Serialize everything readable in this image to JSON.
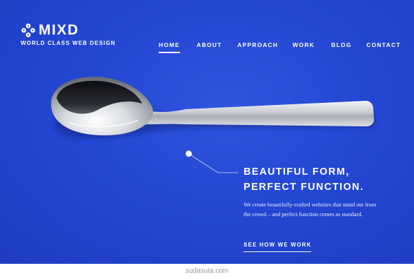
{
  "brand": {
    "name": "MIXD",
    "tagline": "WORLD CLASS WEB DESIGN",
    "logo_icon": "flower-logo-icon"
  },
  "nav": {
    "items": [
      {
        "label": "HOME",
        "active": true
      },
      {
        "label": "ABOUT",
        "active": false
      },
      {
        "label": "APPROACH",
        "active": false
      },
      {
        "label": "WORK",
        "active": false
      },
      {
        "label": "BLOG",
        "active": false
      },
      {
        "label": "CONTACT",
        "active": false
      }
    ]
  },
  "hero": {
    "image": "spoon-image",
    "headline_line1": "BEAUTIFUL FORM,",
    "headline_line2": "PERFECT FUNCTION.",
    "body": "We create beautifully-crafted websites that stand out from the crowd – and perfect function comes as standard.",
    "cta_label": "SEE HOW WE WORK"
  },
  "footer": {
    "watermark": "sudasuta.com"
  },
  "colors": {
    "background": "#2447d2",
    "text": "#ffffff",
    "footer_bg": "#ffffff",
    "watermark": "#9a9a9a"
  }
}
